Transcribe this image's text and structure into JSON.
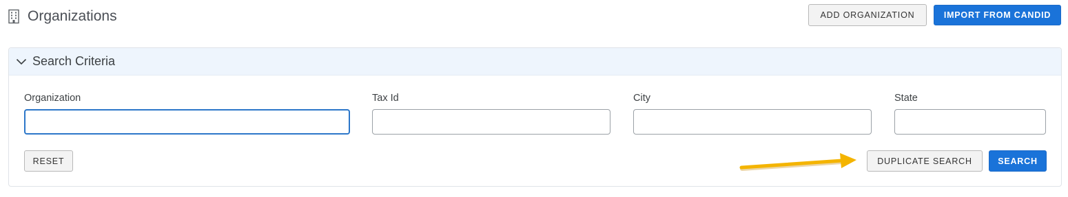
{
  "header": {
    "title": "Organizations",
    "icon": "building-icon",
    "add_label": "ADD ORGANIZATION",
    "import_label": "IMPORT FROM CANDID"
  },
  "search_criteria": {
    "title": "Search Criteria",
    "expanded": true,
    "fields": {
      "organization": {
        "label": "Organization",
        "value": ""
      },
      "tax_id": {
        "label": "Tax Id",
        "value": ""
      },
      "city": {
        "label": "City",
        "value": ""
      },
      "state": {
        "label": "State",
        "value": ""
      }
    },
    "reset_label": "RESET",
    "duplicate_search_label": "DUPLICATE SEARCH",
    "search_label": "SEARCH"
  },
  "colors": {
    "primary": "#1a73d9",
    "panel_header": "#eef5fd",
    "annotation_arrow": "#f4b400"
  }
}
